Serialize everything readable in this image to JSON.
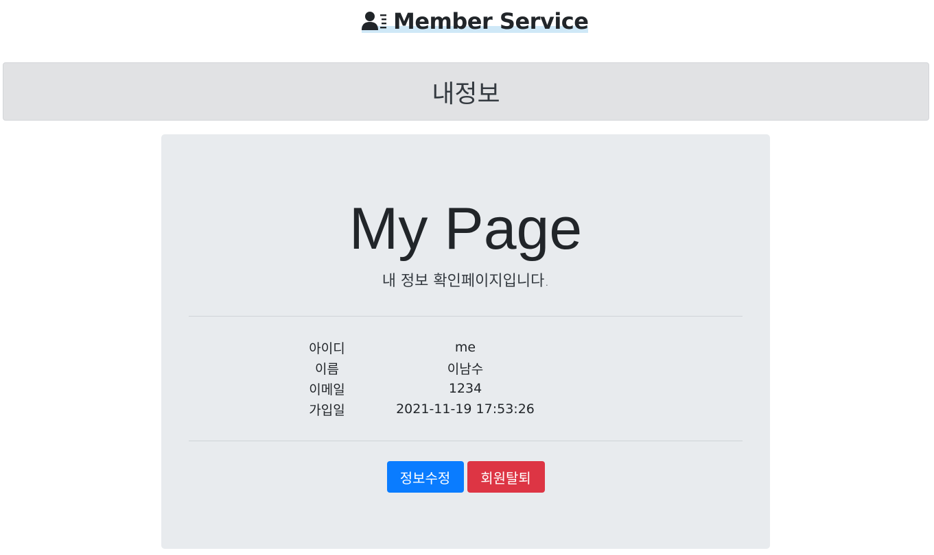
{
  "header": {
    "brand_text": "Member Service",
    "brand_icon": "user-list-icon"
  },
  "banner": {
    "title": "내정보"
  },
  "main": {
    "title": "My Page",
    "subtitle": "내 정보 확인페이지입니다.",
    "info": [
      {
        "label": "아이디",
        "value": "me"
      },
      {
        "label": "이름",
        "value": "이남수"
      },
      {
        "label": "이메일",
        "value": "1234"
      },
      {
        "label": "가입일",
        "value": "2021-11-19 17:53:26"
      }
    ],
    "actions": {
      "edit_label": "정보수정",
      "withdraw_label": "회원탈퇴"
    }
  },
  "colors": {
    "primary": "#0a7cff",
    "danger": "#dd3544",
    "banner_bg": "#e1e2e4",
    "jumbotron_bg": "#e8ebee"
  }
}
